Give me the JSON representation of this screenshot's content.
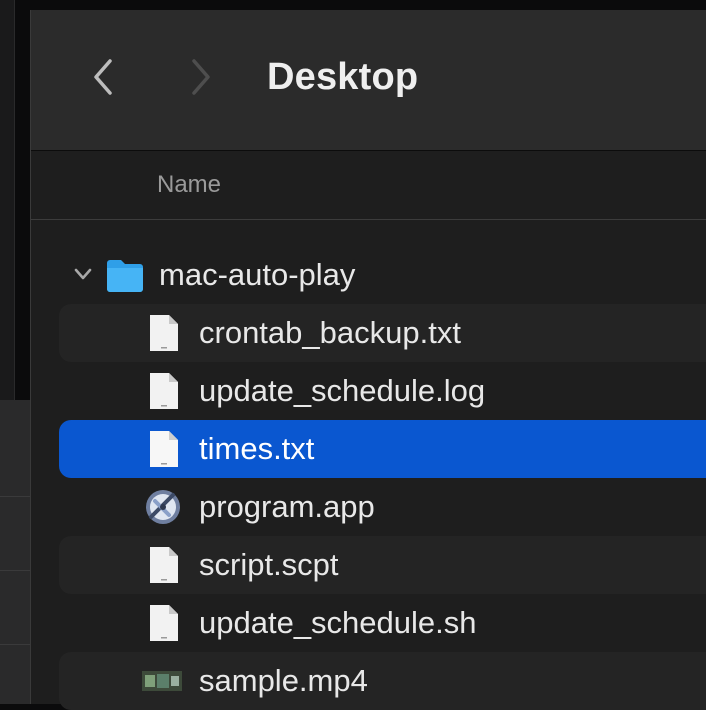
{
  "window": {
    "title": "Desktop"
  },
  "toolbar": {
    "back_icon": "chevron-left-icon",
    "forward_icon": "chevron-right-icon"
  },
  "columns": {
    "name": "Name"
  },
  "items": [
    {
      "label": "mac-auto-play",
      "icon": "folder-icon",
      "expanded": true
    },
    {
      "label": "crontab_backup.txt",
      "icon": "document-icon"
    },
    {
      "label": "update_schedule.log",
      "icon": "document-icon"
    },
    {
      "label": "times.txt",
      "icon": "document-icon",
      "selected": true
    },
    {
      "label": "program.app",
      "icon": "application-icon"
    },
    {
      "label": "script.scpt",
      "icon": "document-icon"
    },
    {
      "label": "update_schedule.sh",
      "icon": "document-icon"
    },
    {
      "label": "sample.mp4",
      "icon": "video-icon"
    }
  ],
  "colors": {
    "selection": "#0a57d0",
    "folder": "#2f9fe8",
    "toolbar": "#2b2b2b",
    "list_bg": "#1e1e1e"
  }
}
